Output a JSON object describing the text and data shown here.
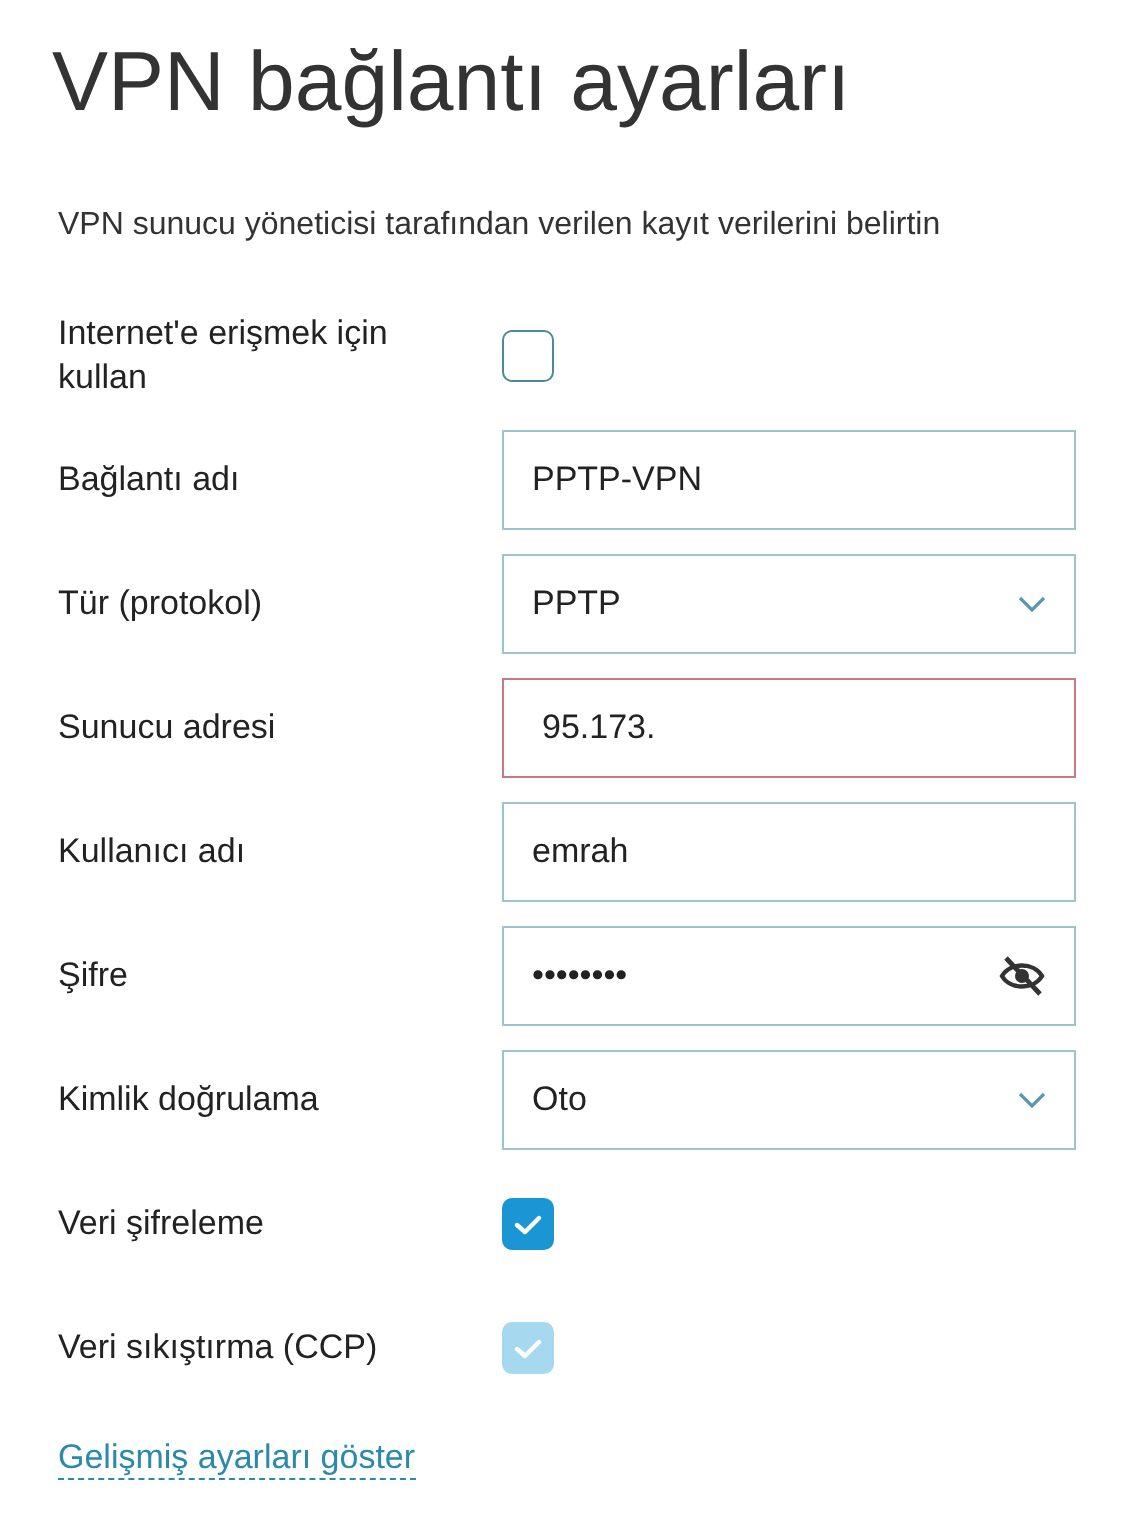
{
  "title": "VPN bağlantı ayarları",
  "subtitle": "VPN sunucu yöneticisi tarafından verilen kayıt verilerini belirtin",
  "fields": [
    {
      "kind": "checkbox",
      "label": "Internet'e erişmek için kullan",
      "checked": false,
      "disabled": false
    },
    {
      "kind": "text",
      "label": "Bağlantı adı",
      "value": "PPTP-VPN",
      "invalid": false
    },
    {
      "kind": "select",
      "label": "Tür (protokol)",
      "value": "PPTP"
    },
    {
      "kind": "text",
      "label": "Sunucu adresi",
      "value": "95.173.",
      "invalid": true
    },
    {
      "kind": "text",
      "label": "Kullanıcı adı",
      "value": "emrah",
      "invalid": false
    },
    {
      "kind": "password",
      "label": "Şifre",
      "value": "••••••••"
    },
    {
      "kind": "select",
      "label": "Kimlik doğrulama",
      "value": "Oto"
    },
    {
      "kind": "checkbox",
      "label": "Veri şifreleme",
      "checked": true,
      "disabled": false
    },
    {
      "kind": "checkbox",
      "label": "Veri sıkıştırma (CCP)",
      "checked": true,
      "disabled": true
    }
  ],
  "link": "Gelişmiş ayarları göster"
}
